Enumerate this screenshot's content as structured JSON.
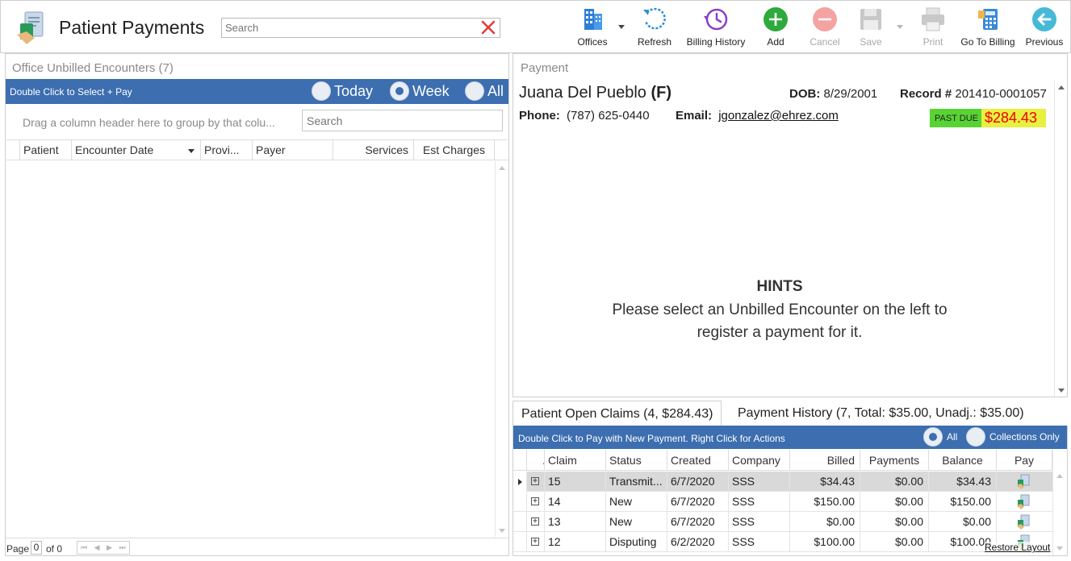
{
  "app": {
    "title": "Patient Payments",
    "search_placeholder": "Search"
  },
  "toolbar": {
    "offices": "Offices",
    "refresh": "Refresh",
    "billing_history": "Billing History",
    "add": "Add",
    "cancel": "Cancel",
    "save": "Save",
    "print": "Print",
    "go_to_billing": "Go To Billing",
    "previous": "Previous"
  },
  "unbilled": {
    "caption": "Office Unbilled Encounters (7)",
    "bar_text": "Double Click to Select + Pay",
    "filters": [
      "Today",
      "Week",
      "All"
    ],
    "selected_filter": "Week",
    "group_hint": "Drag a column header here to group by that colu...",
    "search_placeholder": "Search",
    "columns": [
      "Patient",
      "Encounter Date",
      "Provi...",
      "Payer",
      "Services",
      "Est Charges"
    ],
    "pager": {
      "page_label": "Page",
      "page": "0",
      "of": "of 0",
      "nav": "⏮ ◀ ▶ ⏭"
    }
  },
  "payment": {
    "caption": "Payment",
    "patient_name": "Juana Del Pueblo",
    "gender": "(F)",
    "dob_label": "DOB:",
    "dob": "8/29/2001",
    "record_label": "Record #",
    "record": "201410-0001057",
    "phone_label": "Phone:",
    "phone": "(787) 625-0440",
    "email_label": "Email:",
    "email": "jgonzalez@ehrez.com",
    "past_due_label": "PAST DUE",
    "past_due_amount": "$284.43",
    "hints_title": "HINTS",
    "hints_line1": "Please select an Unbilled Encounter on the left to",
    "hints_line2": "register a payment for it."
  },
  "tabs": [
    {
      "label": "Patient Open Claims (4, $284.43)",
      "active": true
    },
    {
      "label": "Payment History (7, Total: $35.00, Unadj.: $35.00)",
      "active": false
    }
  ],
  "claims": {
    "bar_text": "Double Click to Pay with New Payment. Right Click for Actions",
    "filters": [
      "All",
      "Collections Only"
    ],
    "selected_filter": "All",
    "columns": [
      ".",
      "Claim",
      "Status",
      "Created",
      "Company",
      "Billed",
      "Payments",
      "Balance",
      "Pay"
    ],
    "rows": [
      {
        "claim": "15",
        "status": "Transmit...",
        "created": "6/7/2020",
        "company": "SSS",
        "billed": "$34.43",
        "payments": "$0.00",
        "balance": "$34.43"
      },
      {
        "claim": "14",
        "status": "New",
        "created": "6/7/2020",
        "company": "SSS",
        "billed": "$150.00",
        "payments": "$0.00",
        "balance": "$150.00"
      },
      {
        "claim": "13",
        "status": "New",
        "created": "6/7/2020",
        "company": "SSS",
        "billed": "$0.00",
        "payments": "$0.00",
        "balance": "$0.00"
      },
      {
        "claim": "12",
        "status": "Disputing",
        "created": "6/2/2020",
        "company": "SSS",
        "billed": "$100.00",
        "payments": "$0.00",
        "balance": "$100.00"
      }
    ],
    "restore_layout": "Restore Layout",
    "expand_symbol": "+"
  },
  "colors": {
    "accent_blue": "#3c6eb0",
    "past_due_green": "#58d334",
    "past_due_yellow": "#e8f040",
    "past_due_red": "#ee0000",
    "add_green": "#2eaa3c",
    "cancel_red": "#f07070"
  },
  "icons": {
    "app": "payment-document-icon",
    "search_clear": "close-x-icon",
    "offices": "building-icon",
    "refresh": "refresh-icon",
    "billing_history": "history-clock-icon",
    "add": "plus-circle-icon",
    "cancel": "minus-circle-icon",
    "save": "floppy-disk-icon",
    "print": "printer-icon",
    "go_to_billing": "billing-calculator-icon",
    "previous": "arrow-left-circle-icon",
    "pay": "pay-document-icon"
  }
}
